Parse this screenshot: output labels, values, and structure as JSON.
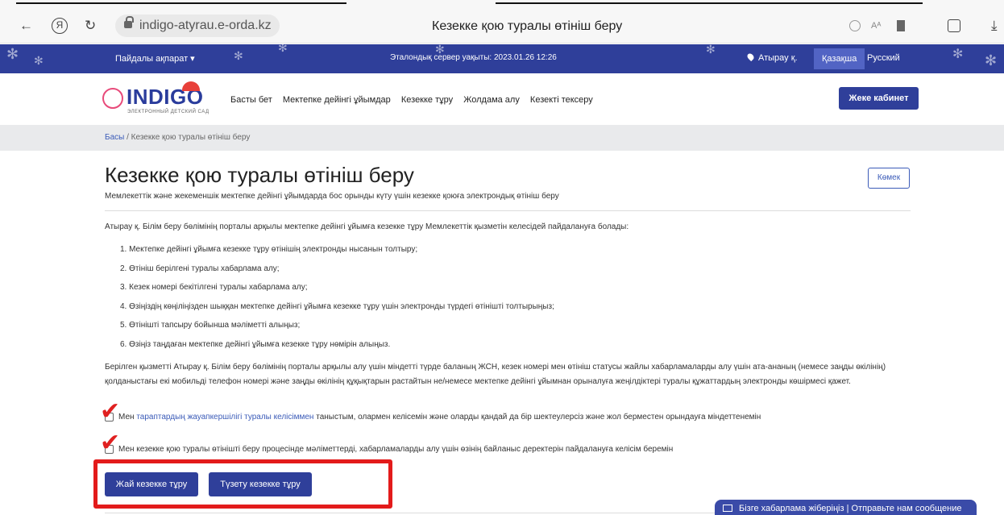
{
  "browser": {
    "back_icon": "←",
    "yandex_icon": "Я",
    "reload_icon": "↻",
    "url": "indigo-atyrau.e-orda.kz",
    "tab_title": "Кезекке қою туралы өтініш беру",
    "translate_label": "Aᴬ",
    "download_icon": "⤓"
  },
  "topbar": {
    "useful_info": "Пайдалы ақпарат ▾",
    "server_time": "Эталондық сервер уақыты: 2023.01.26 12:26",
    "city": "Атырау қ.",
    "lang_kz": "Қазақша",
    "lang_ru": "Русский"
  },
  "nav": {
    "logo_word": "INDIGO",
    "logo_sub": "ЭЛЕКТРОННЫЙ ДЕТСКИЙ САД",
    "links": [
      "Басты бет",
      "Мектепке дейінгі ұйымдар",
      "Кезекке тұру",
      "Жолдама алу",
      "Кезекті тексеру"
    ],
    "cabinet": "Жеке кабинет"
  },
  "breadcrumb": {
    "home": "Басы",
    "sep": " / ",
    "current": "Кезекке қою туралы өтініш беру"
  },
  "main": {
    "title": "Кезекке қою туралы өтініш беру",
    "help": "Көмек",
    "subtitle": "Мемлекеттік және жекеменшік мектепке дейінгі ұйымдарда бос орынды күту үшін кезекке қоюға электрондық өтініш беру",
    "intro": "Атырау қ. Білім беру бөлімінің порталы арқылы мектепке дейінгі ұйымға кезекке тұру Мемлекеттік қызметін келесідей пайдалануға болады:",
    "steps": [
      "1. Мектепке дейінгі ұйымға кезекке тұру өтінішің электронды нысанын толтыру;",
      "2. Өтініш берілгені туралы хабарлама алу;",
      "3. Кезек номері бекітілгені туралы хабарлама алу;",
      "4. Өзіңіздің көңіліңізден шыққан мектепке дейінгі ұйымға кезекке тұру үшін электронды түрдегі өтінішті толтырыңыз;",
      "5. Өтінішті тапсыру бойынша мәліметті алыңыз;",
      "6. Өзіңіз таңдаған мектепке дейінгі ұйымға кезекке тұру нөмірін алыңыз."
    ],
    "note": "Берілген қызметті Атырау қ. Білім беру бөлімінің порталы арқылы алу үшін міндетті түрде баланың ЖСН, кезек номері мен өтініш статусы жайлы хабарламаларды алу үшін ата-ананың (немесе заңды өкілінің) қолданыстағы екі мобильді телефон номері және заңды өкілінің құқықтарын растайтын не/немесе мектепке дейінгі ұйымнан орыналуға жеңілдіктері туралы құжаттардың электронды көшірмесі қажет.",
    "agree1_pre": "Мен ",
    "agree1_link": "тараптардың жауапкершілігі туралы келісіммен",
    "agree1_post": " таныстым, олармен келісемін және оларды қандай да бір шектеулерсіз және жол берместен орындауға міндеттенемін",
    "agree2": "Мен кезекке қою туралы өтінішті беру процесінде мәліметтерді, хабарламаларды алу үшін өзінің байланыс деректерін пайдалануға келісім беремін",
    "btn_simple": "Жай кезекке тұру",
    "btn_correct": "Түзету кезекке тұру"
  },
  "feedback": {
    "label": "Бізге хабарлама жіберіңіз | Отправьте нам сообщение"
  },
  "colors": {
    "brand": "#2f3f9a",
    "highlight": "#e31b1b"
  }
}
